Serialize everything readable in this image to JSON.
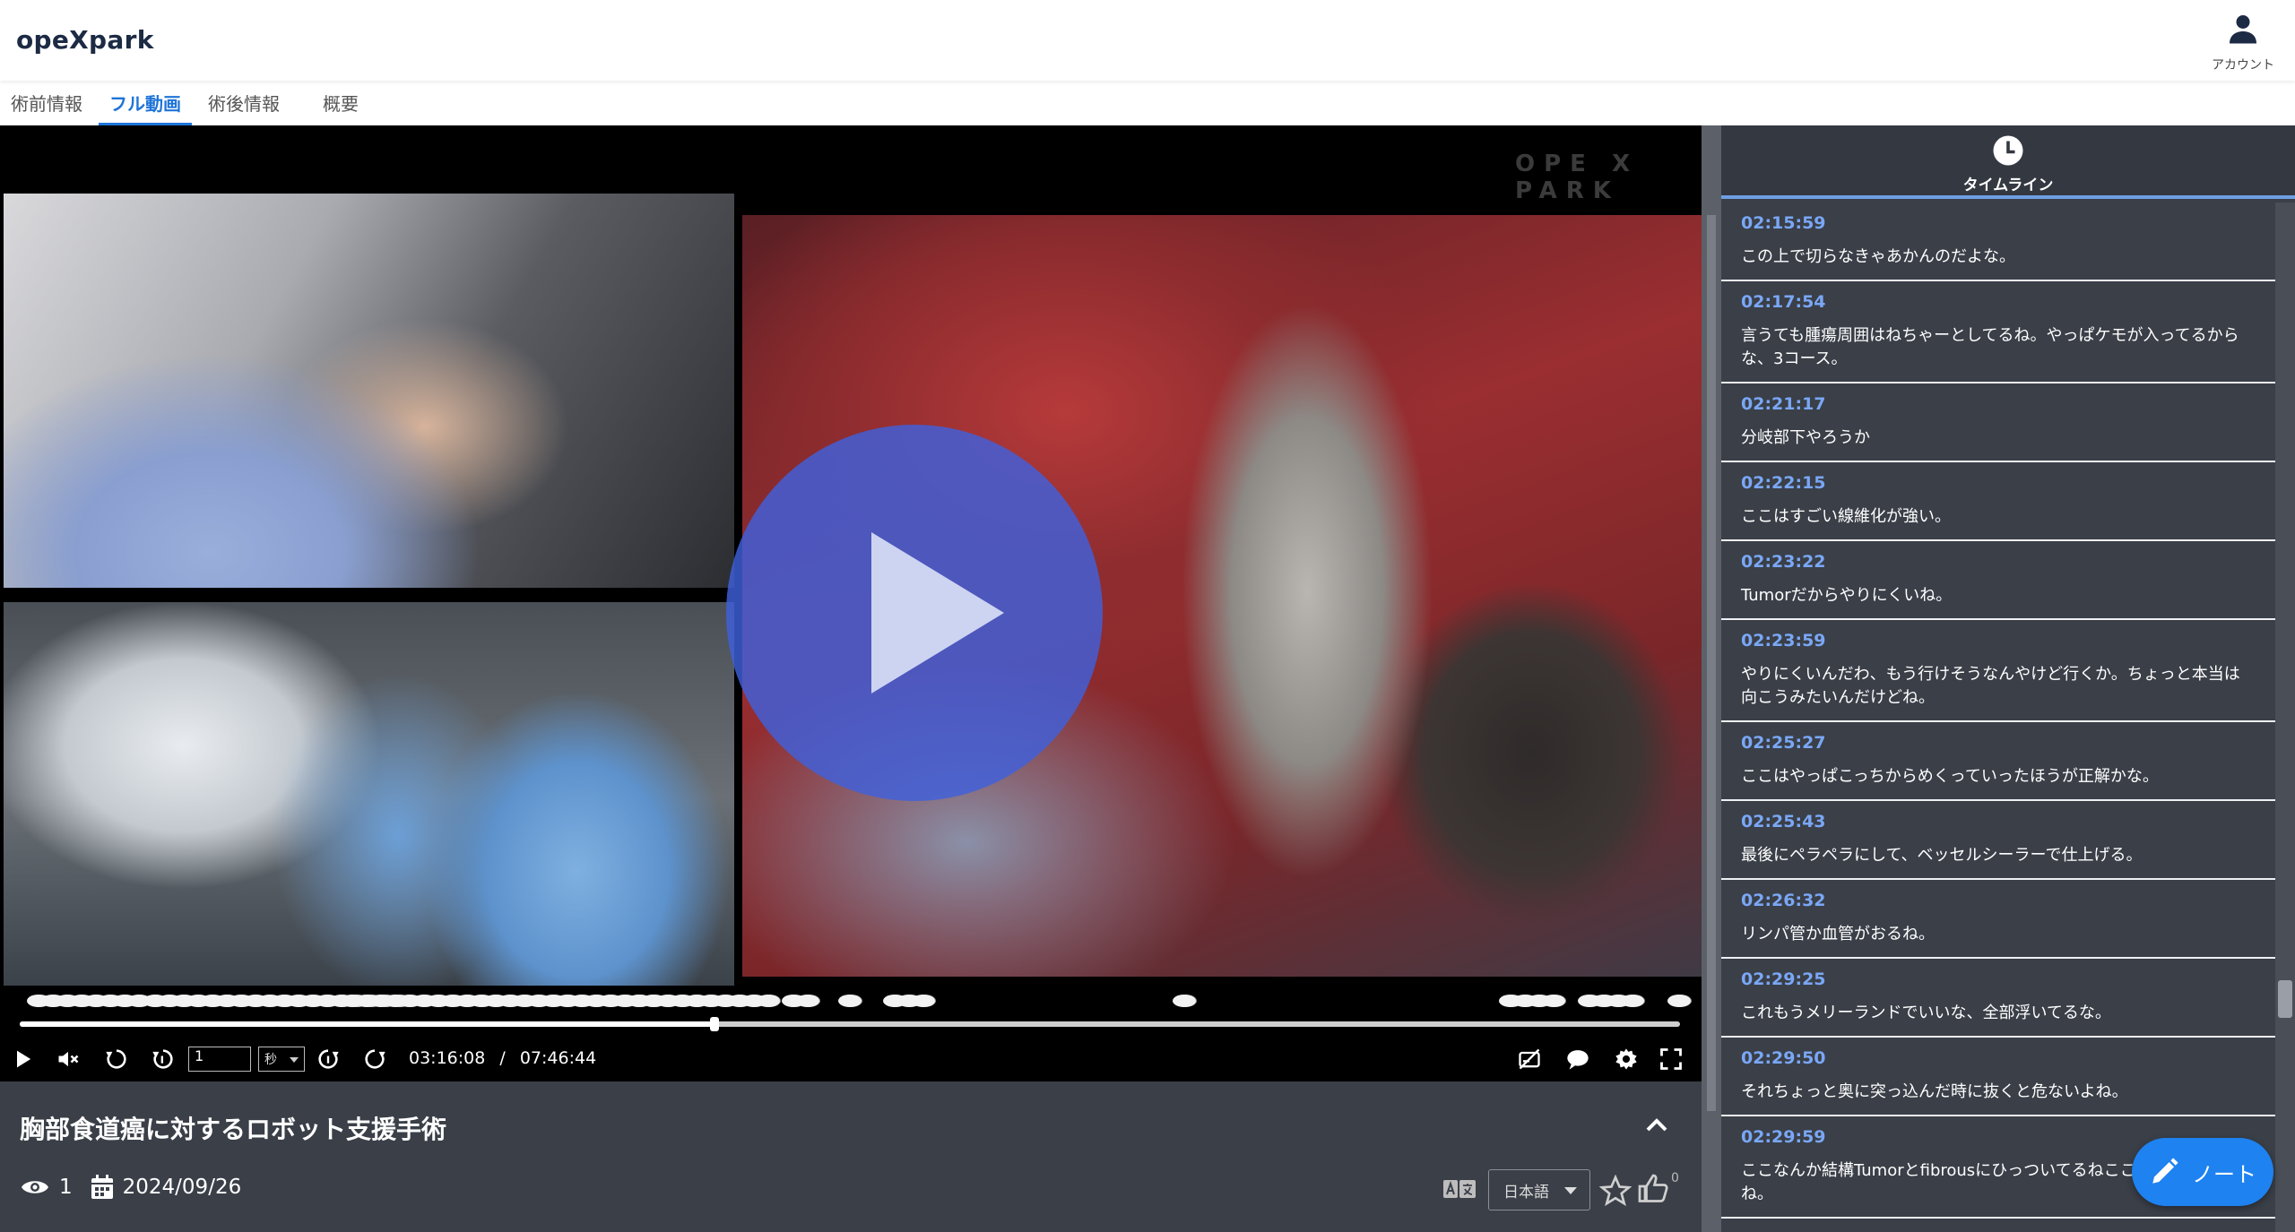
{
  "app": {
    "logo": "opeXpark"
  },
  "header": {
    "account_label": "アカウント"
  },
  "tabs": [
    {
      "label": "術前情報",
      "active": false
    },
    {
      "label": "フル動画",
      "active": true
    },
    {
      "label": "術後情報",
      "active": false
    },
    {
      "label": "概要",
      "active": false
    }
  ],
  "player": {
    "watermark": "OPE X PARK",
    "progress": 0.4183,
    "step_value": "1",
    "step_unit": "秒",
    "current_time": "03:16:08",
    "separator": "/",
    "duration": "07:46:44"
  },
  "video_info": {
    "title": "胸部食道癌に対するロボット支援手術",
    "views": "1",
    "date": "2024/09/26",
    "language": "日本語",
    "like_count": "0"
  },
  "timeline": {
    "label": "タイムライン",
    "entries": [
      {
        "time": "02:15:59",
        "text": "この上で切らなきゃあかんのだよな。"
      },
      {
        "time": "02:17:54",
        "text": "言うても腫瘍周囲はねちゃーとしてるね。やっぱケモが入ってるからな、3コース。"
      },
      {
        "time": "02:21:17",
        "text": "分岐部下やろうか"
      },
      {
        "time": "02:22:15",
        "text": "ここはすごい線維化が強い。"
      },
      {
        "time": "02:23:22",
        "text": "Tumorだからやりにくいね。"
      },
      {
        "time": "02:23:59",
        "text": "やりにくいんだわ、もう行けそうなんやけど行くか。ちょっと本当は向こうみたいんだけどね。"
      },
      {
        "time": "02:25:27",
        "text": "ここはやっぱこっちからめくっていったほうが正解かな。"
      },
      {
        "time": "02:25:43",
        "text": "最後にペラペラにして、ベッセルシーラーで仕上げる。"
      },
      {
        "time": "02:26:32",
        "text": "リンパ管か血管がおるね。"
      },
      {
        "time": "02:29:25",
        "text": "これもうメリーランドでいいな、全部浮いてるな。"
      },
      {
        "time": "02:29:50",
        "text": "それちょっと奥に突っ込んだ時に抜くと危ないよね。"
      },
      {
        "time": "02:29:59",
        "text": "ここなんか結構Tumorとfibrousにひっついてるねここも。やらしいね。"
      }
    ]
  },
  "note_button": {
    "label": "ノート"
  },
  "colors": {
    "accent": "#1e74d8",
    "timeline_time": "#7aa7f5",
    "panel": "#3a3f48",
    "play_overlay": "#4060dc",
    "note_button": "#1e82f0"
  },
  "icons": [
    "account-icon",
    "play-icon",
    "mute-icon",
    "rewind-icon",
    "step-back-icon",
    "step-forward-icon",
    "forward-icon",
    "subtitles-off-icon",
    "comment-icon",
    "gear-icon",
    "fullscreen-icon",
    "eye-icon",
    "calendar-icon",
    "translate-icon",
    "star-icon",
    "thumbs-up-icon",
    "clock-icon",
    "pencil-icon",
    "chevron-up-icon"
  ]
}
